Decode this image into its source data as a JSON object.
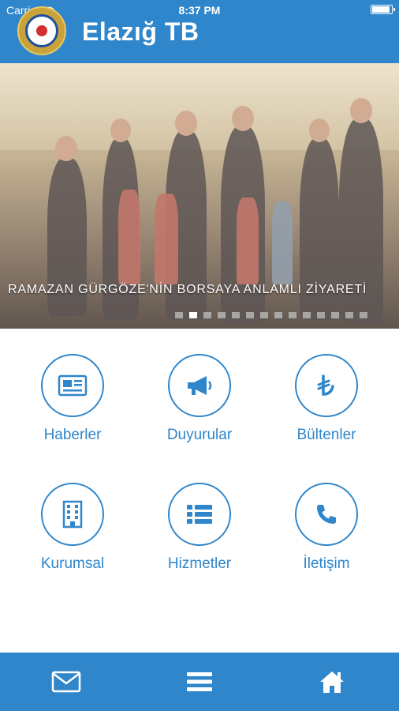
{
  "status_bar": {
    "carrier": "Carrier",
    "time": "8:37 PM",
    "battery_level": 0.95
  },
  "header": {
    "title": "Elazığ TB",
    "logo_icon": "chamber-logo-icon"
  },
  "banner": {
    "caption": "RAMAZAN GÜRGÖZE'NİN BORSAYA ANLAMLI ZİYARETİ",
    "slide_count": 14,
    "active_slide": 1
  },
  "menu": {
    "items": [
      {
        "label": "Haberler",
        "icon": "newspaper-icon"
      },
      {
        "label": "Duyurular",
        "icon": "megaphone-icon"
      },
      {
        "label": "Bültenler",
        "icon": "lira-icon"
      },
      {
        "label": "Kurumsal",
        "icon": "building-icon"
      },
      {
        "label": "Hizmetler",
        "icon": "list-icon"
      },
      {
        "label": "İletişim",
        "icon": "phone-icon"
      }
    ]
  },
  "tabbar": {
    "items": [
      {
        "icon": "mail-icon"
      },
      {
        "icon": "menu-icon"
      },
      {
        "icon": "home-icon"
      }
    ]
  },
  "colors": {
    "primary": "#2f86cb",
    "background": "#ffffff"
  }
}
